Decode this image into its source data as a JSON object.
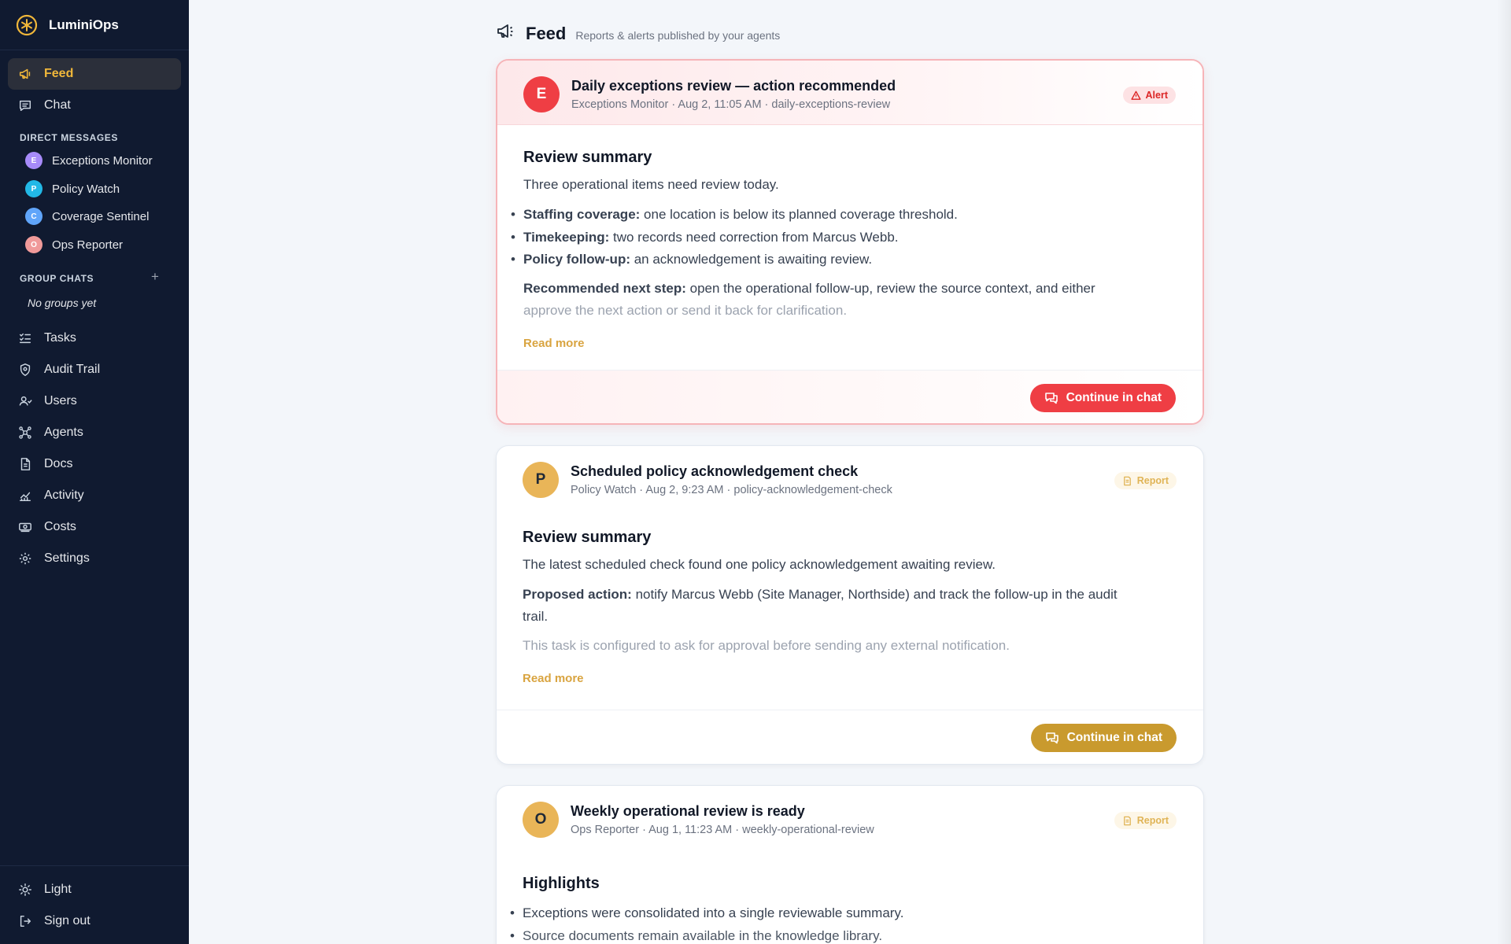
{
  "app": {
    "name": "LuminiOps"
  },
  "nav": {
    "feed": "Feed",
    "chat": "Chat",
    "tasks": "Tasks",
    "audit": "Audit Trail",
    "users": "Users",
    "agents": "Agents",
    "docs": "Docs",
    "activity": "Activity",
    "costs": "Costs",
    "settings": "Settings",
    "theme": "Light",
    "signout": "Sign out"
  },
  "direct_messages": {
    "label": "DIRECT MESSAGES",
    "items": [
      {
        "initial": "E",
        "name": "Exceptions Monitor",
        "color": "#a78bfa"
      },
      {
        "initial": "P",
        "name": "Policy Watch",
        "color": "#22b8e6"
      },
      {
        "initial": "C",
        "name": "Coverage Sentinel",
        "color": "#60a5fa"
      },
      {
        "initial": "O",
        "name": "Ops Reporter",
        "color": "#f09a9a"
      }
    ]
  },
  "group_chats": {
    "label": "GROUP CHATS",
    "add": "+",
    "empty": "No groups yet"
  },
  "feed": {
    "title": "Feed",
    "subtitle": "Reports & alerts published by your agents"
  },
  "cards": [
    {
      "initial": "E",
      "title": "Daily exceptions review — action recommended",
      "meta": "Exceptions Monitor · Aug 2, 11:05 AM · daily-exceptions-review",
      "badge": "Alert",
      "heading": "Review summary",
      "intro": "Three operational items need review today.",
      "bullets": [
        {
          "label": "Staffing coverage:",
          "text": " one location is below its planned coverage threshold."
        },
        {
          "label": "Timekeeping:",
          "text": " two records need correction from Marcus Webb."
        },
        {
          "label": "Policy follow-up:",
          "text": " an acknowledgement is awaiting review."
        }
      ],
      "next_label": "Recommended next step:",
      "next_text_1": " open the operational follow-up, review the source context, and either",
      "next_text_2": "approve the next action or send it back for clarification.",
      "read_more": "Read more",
      "cta": "Continue in chat"
    },
    {
      "initial": "P",
      "title": "Scheduled policy acknowledgement check",
      "meta": "Policy Watch · Aug 2, 9:23 AM · policy-acknowledgement-check",
      "badge": "Report",
      "heading": "Review summary",
      "intro": "The latest scheduled check found one policy acknowledgement awaiting review.",
      "action_label": "Proposed action:",
      "action_text_1": " notify Marcus Webb (Site Manager, Northside) and track the follow-up in the audit",
      "action_text_2": "trail.",
      "note": "This task is configured to ask for approval before sending any external notification.",
      "read_more": "Read more",
      "cta": "Continue in chat"
    },
    {
      "initial": "O",
      "title": "Weekly operational review is ready",
      "meta": "Ops Reporter · Aug 1, 11:23 AM · weekly-operational-review",
      "badge": "Report",
      "heading": "Highlights",
      "bullets": [
        "Exceptions were consolidated into a single reviewable summary.",
        "Source documents remain available in the knowledge library."
      ]
    }
  ],
  "colors": {
    "accent": "#f0b73a",
    "alert": "#ef3e44",
    "gold": "#c99a2e",
    "sidebar": "#101a30"
  }
}
